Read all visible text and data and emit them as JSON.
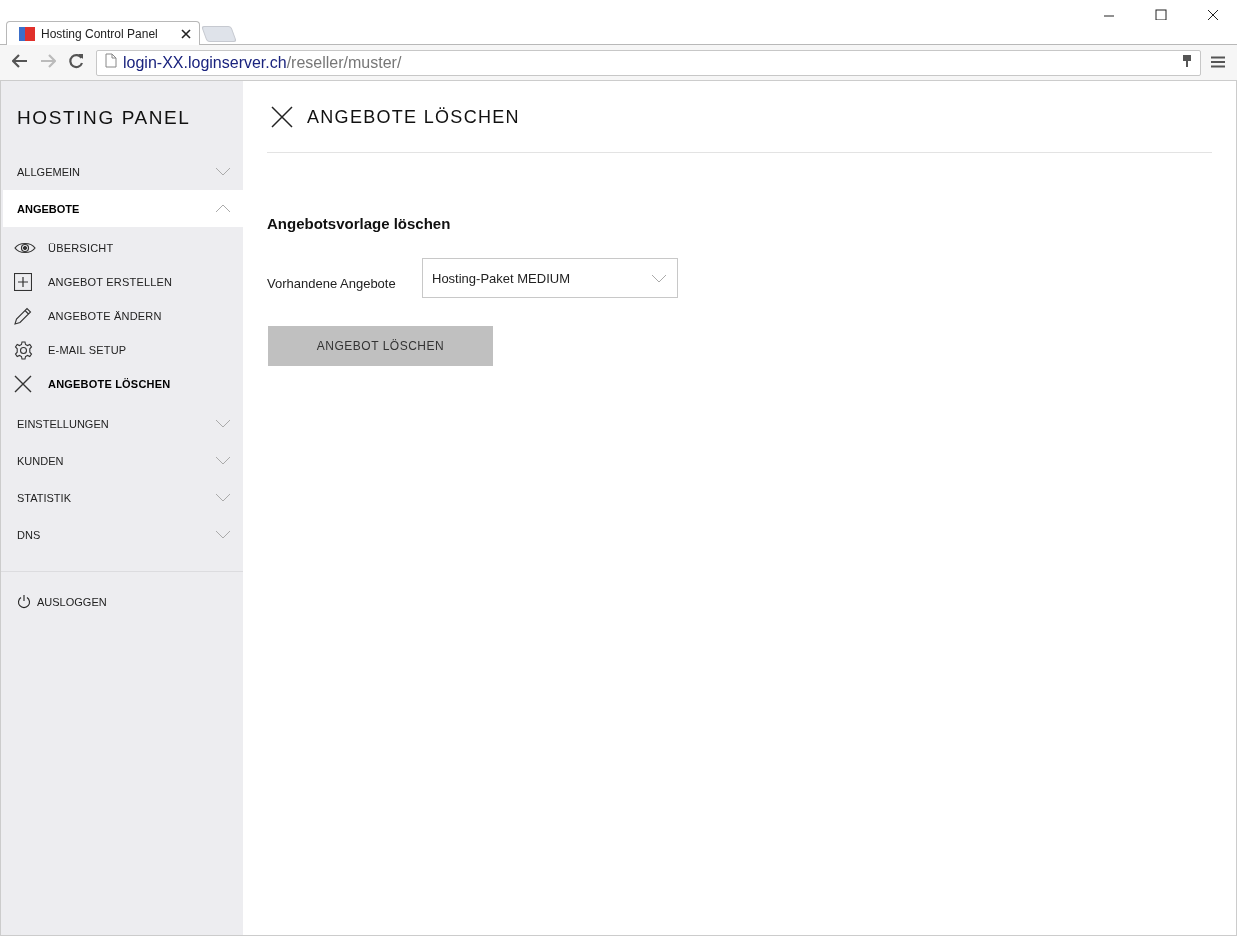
{
  "browser": {
    "tab_title": "Hosting Control Panel",
    "url_host": "login-XX.loginserver.ch",
    "url_path": "/reseller/muster/"
  },
  "sidebar": {
    "brand": "HOSTING PANEL",
    "sections": [
      {
        "label": "ALLGEMEIN",
        "expanded": false
      },
      {
        "label": "ANGEBOTE",
        "expanded": true,
        "children": [
          {
            "label": "ÜBERSICHT",
            "selected": false
          },
          {
            "label": "ANGEBOT ERSTELLEN",
            "selected": false
          },
          {
            "label": "ANGEBOTE ÄNDERN",
            "selected": false
          },
          {
            "label": "E-MAIL SETUP",
            "selected": false
          },
          {
            "label": "ANGEBOTE LÖSCHEN",
            "selected": true
          }
        ]
      },
      {
        "label": "EINSTELLUNGEN",
        "expanded": false
      },
      {
        "label": "KUNDEN",
        "expanded": false
      },
      {
        "label": "STATISTIK",
        "expanded": false
      },
      {
        "label": "DNS",
        "expanded": false
      }
    ],
    "logout": "AUSLOGGEN"
  },
  "main": {
    "title": "ANGEBOTE LÖSCHEN",
    "section_title": "Angebotsvorlage löschen",
    "field_label": "Vorhandene Angebote",
    "select_value": "Hosting-Paket MEDIUM",
    "button": "ANGEBOT LÖSCHEN"
  }
}
